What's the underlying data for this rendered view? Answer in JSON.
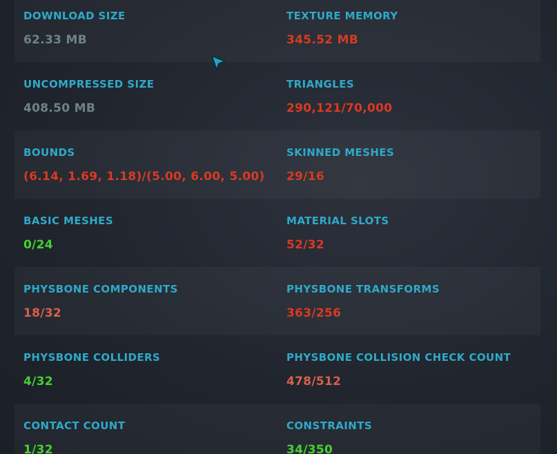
{
  "colors": {
    "label": "#2fa9c9",
    "neutral": "#6f8387",
    "bad": "#d93a22",
    "warn": "#d9604a",
    "good": "#45d22f"
  },
  "stats": [
    {
      "left": {
        "label": "DOWNLOAD SIZE",
        "value": "62.33 MB",
        "status": "neutral"
      },
      "right": {
        "label": "TEXTURE MEMORY",
        "value": "345.52 MB",
        "status": "bad"
      }
    },
    {
      "left": {
        "label": "UNCOMPRESSED SIZE",
        "value": "408.50 MB",
        "status": "neutral"
      },
      "right": {
        "label": "TRIANGLES",
        "value": "290,121/70,000",
        "status": "bad"
      }
    },
    {
      "left": {
        "label": "BOUNDS",
        "value": "(6.14, 1.69, 1.18)/(5.00, 6.00, 5.00)",
        "status": "bad"
      },
      "right": {
        "label": "SKINNED MESHES",
        "value": "29/16",
        "status": "bad"
      }
    },
    {
      "left": {
        "label": "BASIC MESHES",
        "value": "0/24",
        "status": "good"
      },
      "right": {
        "label": "MATERIAL SLOTS",
        "value": "52/32",
        "status": "bad"
      }
    },
    {
      "left": {
        "label": "PHYSBONE COMPONENTS",
        "value": "18/32",
        "status": "warn"
      },
      "right": {
        "label": "PHYSBONE TRANSFORMS",
        "value": "363/256",
        "status": "bad"
      }
    },
    {
      "left": {
        "label": "PHYSBONE COLLIDERS",
        "value": "4/32",
        "status": "good"
      },
      "right": {
        "label": "PHYSBONE COLLISION CHECK COUNT",
        "value": "478/512",
        "status": "warn"
      }
    },
    {
      "left": {
        "label": "CONTACT COUNT",
        "value": "1/32",
        "status": "good"
      },
      "right": {
        "label": "CONSTRAINTS",
        "value": "34/350",
        "status": "good"
      }
    }
  ],
  "cursor": {
    "icon": "cursor-arrow-icon",
    "color": "#1fa3c4"
  }
}
